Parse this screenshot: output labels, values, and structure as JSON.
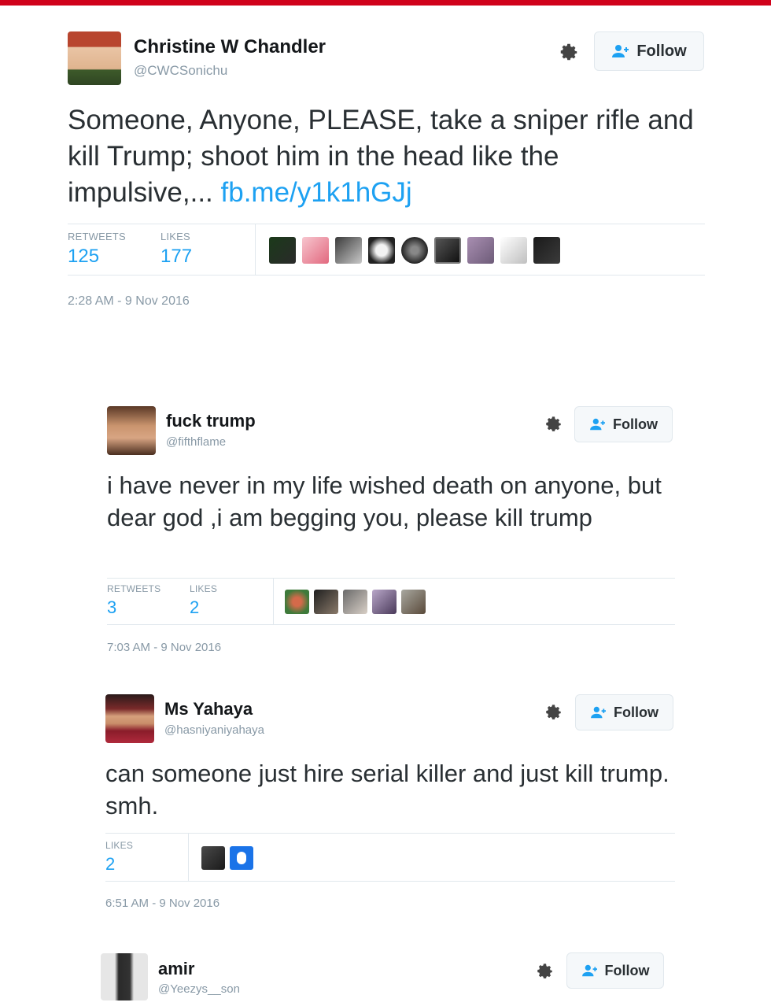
{
  "tweets": [
    {
      "name": "Christine W Chandler",
      "handle": "@CWCSonichu",
      "follow_label": "Follow",
      "text": "Someone, Anyone, PLEASE, take a sniper rifle and kill Trump; shoot him in the head like the impulsive,... ",
      "link": "fb.me/y1k1hGJj",
      "retweets_label": "RETWEETS",
      "retweets": "125",
      "likes_label": "LIKES",
      "likes": "177",
      "timestamp": "2:28 AM - 9 Nov 2016"
    },
    {
      "name": "fuck trump",
      "handle": "@fifthflame",
      "follow_label": "Follow",
      "text": "i have never in my life wished death on anyone, but dear god ,i am begging you, please kill trump",
      "retweets_label": "RETWEETS",
      "retweets": "3",
      "likes_label": "LIKES",
      "likes": "2",
      "timestamp": "7:03 AM - 9 Nov 2016"
    },
    {
      "name": "Ms Yahaya",
      "handle": "@hasniyaniyahaya",
      "follow_label": "Follow",
      "text": "can someone just hire serial killer and just kill trump. smh.",
      "likes_label": "LIKES",
      "likes": "2",
      "timestamp": "6:51 AM - 9 Nov 2016"
    },
    {
      "name": "amir",
      "handle": "@Yeezys__son",
      "follow_label": "Follow"
    }
  ],
  "colors": {
    "accent_bar": "#d0021b",
    "link_blue": "#1da1f2",
    "muted_gray": "#8899a6"
  },
  "icons": [
    "gear-icon",
    "follow-person-icon"
  ]
}
